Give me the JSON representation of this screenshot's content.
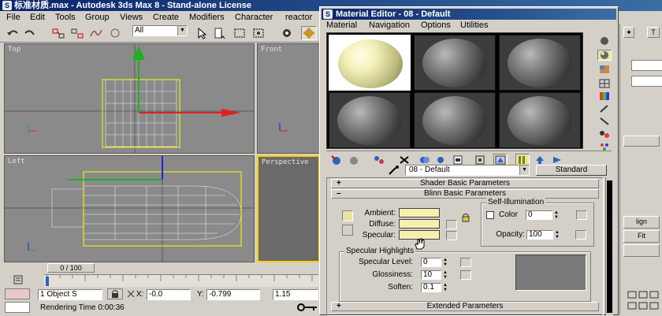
{
  "main_window": {
    "title": "标准材质.max - Autodesk 3ds Max 8 - Stand-alone License",
    "app_icon_glyph": "S",
    "menu": [
      "File",
      "Edit",
      "Tools",
      "Group",
      "Views",
      "Create",
      "Modifiers",
      "Character",
      "reactor"
    ],
    "selection_filter": "All"
  },
  "viewports": {
    "top_label": "Top",
    "front_label": "Front",
    "left_label": "Left",
    "perspective_label": "Perspective"
  },
  "timeline": {
    "frame_display": "0 / 100"
  },
  "status": {
    "object_count": "1 Object S",
    "x_label": "X:",
    "x_value": "-0.0",
    "y_label": "Y:",
    "y_value": "-0.799",
    "z_value": "1.15",
    "rendering_time": "Rendering Time  0:00:36"
  },
  "command_panel": {
    "align_label": "lign",
    "fit_label": "Fit"
  },
  "material_editor": {
    "title": "Material Editor - 08 - Default",
    "menu": [
      "Material",
      "Navigation",
      "Options",
      "Utilities"
    ],
    "material_name": "08 - Default",
    "type_button": "Standard",
    "rollouts": {
      "shader_basic": "Shader Basic Parameters",
      "blinn_basic": "Blinn Basic Parameters",
      "extended": "Extended Parameters"
    },
    "labels": {
      "ambient": "Ambient:",
      "diffuse": "Diffuse:",
      "specular": "Specular:",
      "self_illumination": "Self-Illumination",
      "color": "Color",
      "color_value": "0",
      "opacity": "Opacity:",
      "opacity_value": "100",
      "specular_highlights": "Specular Highlights",
      "specular_level": "Specular Level:",
      "specular_level_value": "0",
      "glossiness": "Glossiness:",
      "glossiness_value": "10",
      "soften": "Soften:",
      "soften_value": "0.1"
    },
    "colors": {
      "ambient": "#f5f0b0",
      "diffuse": "#f5f0b0",
      "specular": "#f5f0b0"
    }
  }
}
